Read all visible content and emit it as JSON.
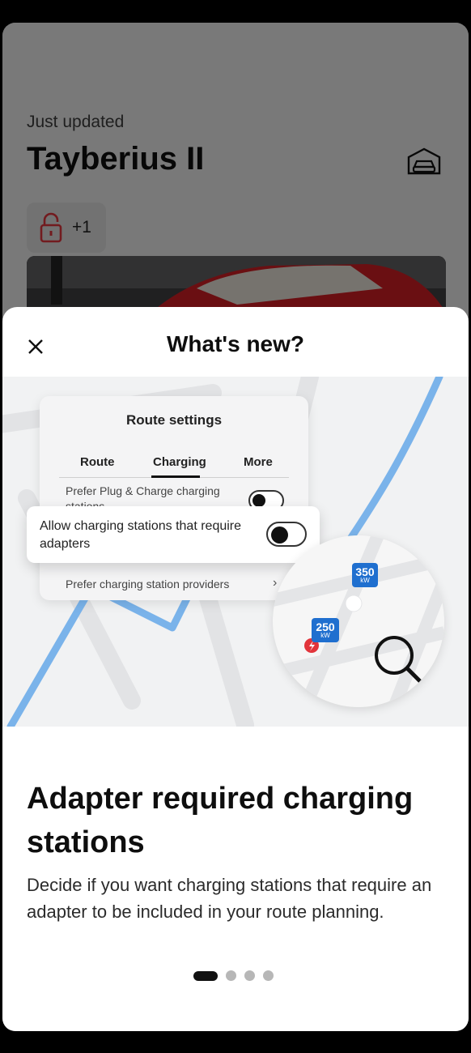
{
  "background": {
    "status_text": "Just updated",
    "vehicle_name": "Tayberius II",
    "lock_badge_count": "+1"
  },
  "sheet": {
    "title": "What's new?",
    "illustration": {
      "panel_title": "Route settings",
      "tabs": [
        "Route",
        "Charging",
        "More"
      ],
      "selected_tab": "Charging",
      "row1_label": "Prefer Plug & Charge charging stations",
      "row2_label": "Allow charging stations that require adapters",
      "row3_label": "Prefer charging station providers",
      "pin_a": {
        "value": "350",
        "unit": "kW"
      },
      "pin_b": {
        "value": "250",
        "unit": "kW"
      }
    },
    "headline": "Adapter required charging stations",
    "description": "Decide if you want charging stations that require an adapter to be included in your route planning.",
    "pager": {
      "total": 4,
      "current": 1
    }
  },
  "colors": {
    "accent_blue": "#1f6fcf",
    "lock_red": "#d0323a",
    "map_route": "#7ab3ea"
  }
}
